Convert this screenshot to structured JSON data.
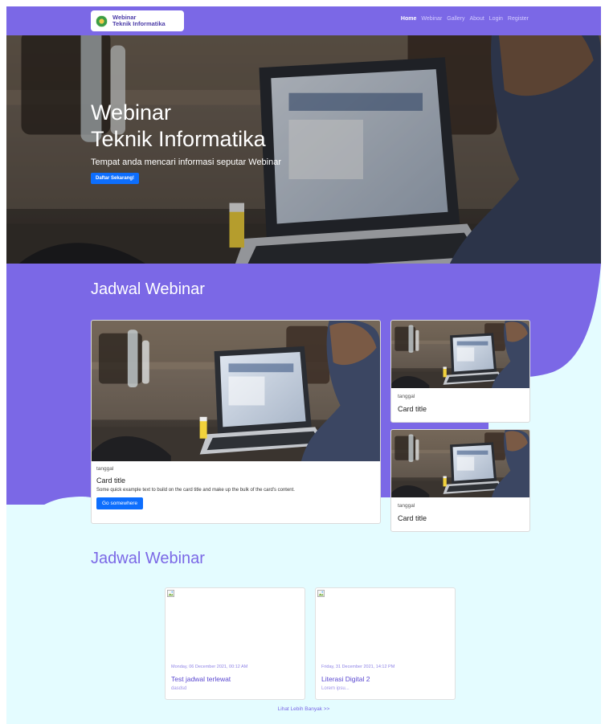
{
  "navbar": {
    "brand_line1": "Webinar",
    "brand_line2": "Teknik Informatika",
    "links": [
      "Home",
      "Webinar",
      "Gallery",
      "About",
      "Login",
      "Register"
    ],
    "active": "Home"
  },
  "hero": {
    "title_line1": "Webinar",
    "title_line2": "Teknik Informatika",
    "subtitle": "Tempat anda mencari informasi seputar Webinar",
    "button": "Daftar Sekarang!"
  },
  "section1": {
    "title": "Jadwal Webinar",
    "featured": {
      "date": "tanggal",
      "title": "Card title",
      "text": "Some quick example text to build on the card title and make up the bulk of the card's content.",
      "button": "Go somewhere"
    },
    "side_cards": [
      {
        "date": "tanggal",
        "title": "Card title"
      },
      {
        "date": "tanggal",
        "title": "Card title"
      }
    ]
  },
  "section2": {
    "title": "Jadwal Webinar",
    "events": [
      {
        "date": "Monday, 06 December 2021, 00:12 AM",
        "title": "Test jadwal terlewat",
        "desc": "dasdsd"
      },
      {
        "date": "Friday, 31 December 2021, 14:12 PM",
        "title": "Literasi Digital 2",
        "desc": "Lorem ipsu..."
      }
    ],
    "more_link": "Lihat Lebih Banyak >>"
  },
  "colors": {
    "primary": "#7b68e6",
    "light_bg": "#e4fcff",
    "button": "#0d6efd"
  }
}
